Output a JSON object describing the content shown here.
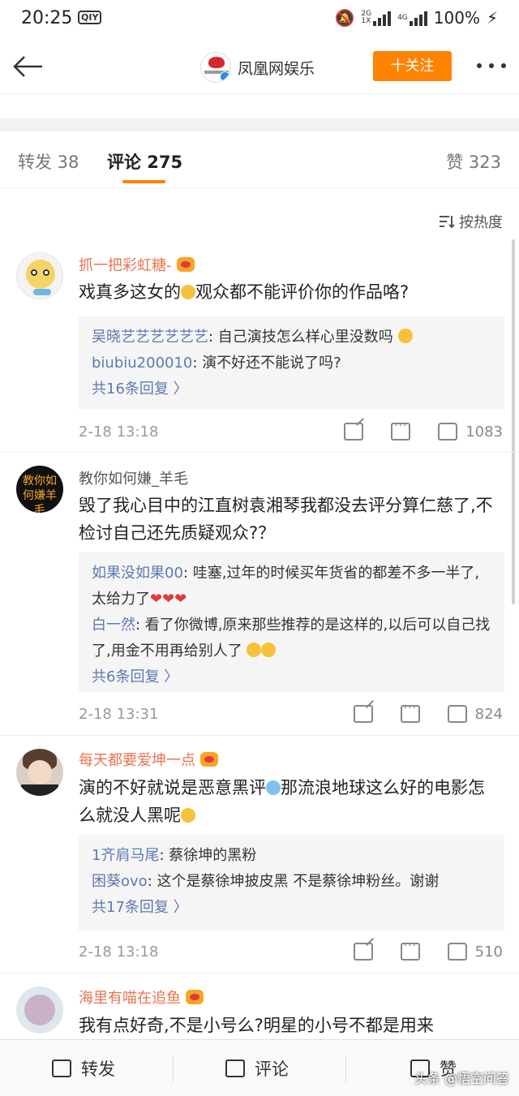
{
  "status_bar": {
    "time": "20:25",
    "app_icon_label": "QIY",
    "net_top": "2G",
    "net_bottom": "1X",
    "net_4g": "4G",
    "battery": "100%"
  },
  "navbar": {
    "title": "凤凰网娱乐",
    "follow_label": "十关注"
  },
  "tabs": {
    "repost": "转发 38",
    "comment": "评论 275",
    "like": "赞 323"
  },
  "sort_label": "按热度",
  "comments": [
    {
      "user": "抓一把彩虹糖-",
      "text_a": "戏真多这女的",
      "text_b": "观众都不能评价你的作品咯?",
      "replies": [
        {
          "name": "吴晓艺艺艺艺艺艺",
          "text": ": 自己演技怎么样心里没数吗"
        },
        {
          "name": "biubiu200010",
          "text": ": 演不好还不能说了吗?"
        }
      ],
      "more": "共16条回复 〉",
      "time": "2-18 13:18",
      "likes": "1083"
    },
    {
      "user": "教你如何嫌_羊毛",
      "avatar_text": "教你如何嫌羊毛",
      "text": "毁了我心目中的江直树袁湘琴我都没去评分算仁慈了,不检讨自己还先质疑观众?？",
      "replies": [
        {
          "name": "如果没如果00",
          "text": ": 哇塞,过年的时候买年货省的都差不多一半了,太给力了",
          "tail": "❤❤❤"
        },
        {
          "name": "白一然",
          "text": ": 看了你微博,原来那些推荐的是这样的,以后可以自己找了,用金不用再给别人了"
        }
      ],
      "more": "共6条回复 〉",
      "time": "2-18 13:31",
      "likes": "824"
    },
    {
      "user": "每天都要爱坤一点",
      "text_a": "演的不好就说是恶意黑评",
      "text_b": "那流浪地球这么好的电影怎么就没人黑呢",
      "replies": [
        {
          "name": "1齐肩马尾",
          "text": ": 蔡徐坤的黑粉"
        },
        {
          "name": "困葵ovo",
          "text": ": 这个是蔡徐坤披皮黑 不是蔡徐坤粉丝。谢谢"
        }
      ],
      "more": "共17条回复 〉",
      "time": "2-18 13:18",
      "likes": "510"
    },
    {
      "user": "海里有喵在追鱼",
      "text": "我有点好奇,不是小号么?明星的小号不都是用来"
    }
  ],
  "bottom_bar": {
    "repost": "转发",
    "comment": "评论",
    "like": "赞"
  },
  "watermark": "头条 @悟空问答",
  "colors": {
    "accent": "#ff8200",
    "username": "#eb7350",
    "reply_name": "#5b7ab0"
  }
}
